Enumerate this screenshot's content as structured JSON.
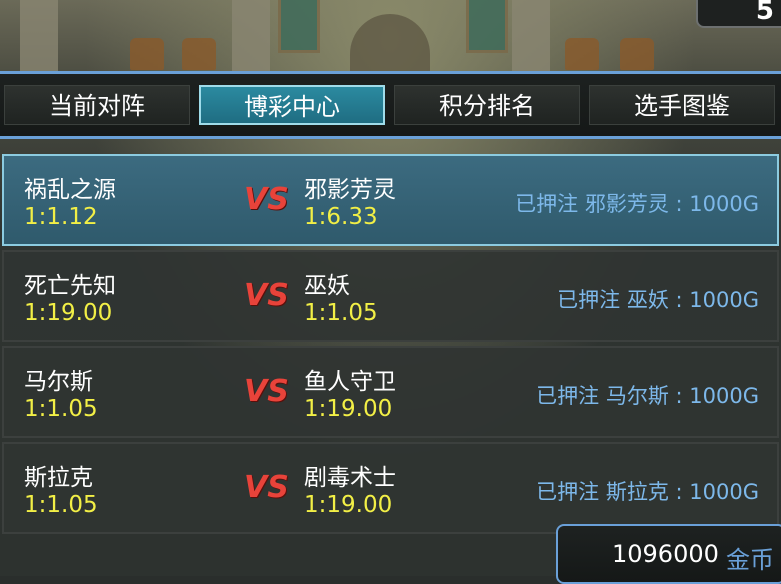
{
  "tabs": [
    {
      "label": "当前对阵",
      "active": false
    },
    {
      "label": "博彩中心",
      "active": true
    },
    {
      "label": "积分排名",
      "active": false
    },
    {
      "label": "选手图鉴",
      "active": false
    }
  ],
  "corner_button": {
    "label": "5"
  },
  "matches": [
    {
      "left_name": "祸乱之源",
      "left_odds": "1:1.12",
      "vs": "VS",
      "right_name": "邪影芳灵",
      "right_odds": "1:6.33",
      "bet": "已押注 邪影芳灵 : 1000G",
      "selected": true
    },
    {
      "left_name": "死亡先知",
      "left_odds": "1:19.00",
      "vs": "VS",
      "right_name": "巫妖",
      "right_odds": "1:1.05",
      "bet": "已押注 巫妖 : 1000G",
      "selected": false
    },
    {
      "left_name": "马尔斯",
      "left_odds": "1:1.05",
      "vs": "VS",
      "right_name": "鱼人守卫",
      "right_odds": "1:19.00",
      "bet": "已押注 马尔斯 : 1000G",
      "selected": false
    },
    {
      "left_name": "斯拉克",
      "left_odds": "1:1.05",
      "vs": "VS",
      "right_name": "剧毒术士",
      "right_odds": "1:19.00",
      "bet": "已押注 斯拉克 : 1000G",
      "selected": false
    }
  ],
  "gold": {
    "amount": "1096000",
    "unit": "金币"
  },
  "colors": {
    "accent": "#6aa0d8",
    "odds": "#f2ef46",
    "vs": "#e8433a",
    "bet_text": "#7db8ea",
    "tab_active": "#2b8aa0"
  }
}
